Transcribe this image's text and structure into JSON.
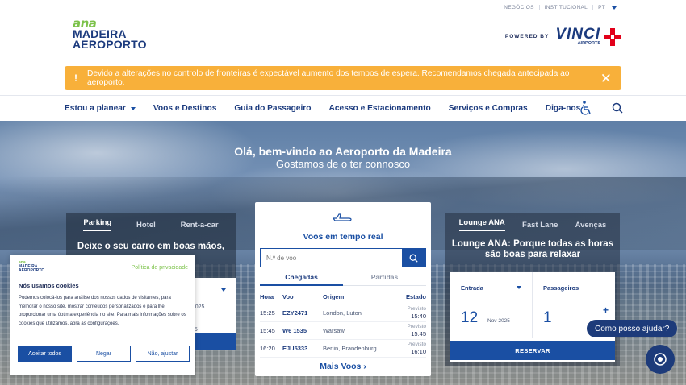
{
  "topbar": {
    "links": [
      "NEGÓCIOS",
      "INSTITUCIONAL"
    ],
    "language": "PT"
  },
  "logo": {
    "ana": "ana",
    "line1": "MADEIRA",
    "line2": "AEROPORTO"
  },
  "vinci": {
    "powered": "POWERED BY",
    "brand": "VINCI",
    "sub": "AIRPORTS"
  },
  "alert": {
    "icon": "!",
    "text": "Devido a alterações no controlo de fronteiras é expectável aumento dos tempos de espera. Recomendamos chegada antecipada ao aeroporto.",
    "close": "✕"
  },
  "nav": {
    "items": [
      "Estou a planear",
      "Voos e Destinos",
      "Guia do Passageiro",
      "Acesso e Estacionamento",
      "Serviços e Compras",
      "Diga-nos"
    ],
    "icons": [
      "accessibility-icon",
      "search-icon"
    ]
  },
  "hero": {
    "title": "Olá, bem-vindo ao Aeroporto da Madeira",
    "subtitle": "Gostamos de o ter connosco"
  },
  "parking": {
    "tabs": [
      "Parking",
      "Hotel",
      "Rent-a-car"
    ],
    "headline": "Deixe o seu carro em boas mãos,",
    "partial_date": "0 2025",
    "partial_time": "45"
  },
  "flights": {
    "title": "Voos em tempo real",
    "search_placeholder": "N.º de voo",
    "tabs": [
      "Chegadas",
      "Partidas"
    ],
    "columns": [
      "Hora",
      "Voo",
      "Origem",
      "Estado"
    ],
    "rows": [
      {
        "time": "15:25",
        "flight": "EZY2471",
        "origin": "London, Luton",
        "status": "Previsto",
        "status_time": "15:40"
      },
      {
        "time": "15:45",
        "flight": "W6 1535",
        "origin": "Warsaw",
        "status": "Previsto",
        "status_time": "15:45"
      },
      {
        "time": "16:20",
        "flight": "EJU5333",
        "origin": "Berlin, Brandenburg",
        "status": "Previsto",
        "status_time": "16:10"
      }
    ],
    "more": "Mais Voos"
  },
  "lounge": {
    "tabs": [
      "Lounge ANA",
      "Fast Lane",
      "Avenças"
    ],
    "headline1": "Lounge ANA: Porque todas as horas",
    "headline2": "são boas para relaxar",
    "entry_label": "Entrada",
    "entry_day": "12",
    "entry_month": "Nov 2025",
    "pax_label": "Passageiros",
    "pax_value": "1",
    "plus": "+",
    "reserve": "RESERVAR"
  },
  "cookie": {
    "policy": "Política de privacidade",
    "title": "Nós usamos cookies",
    "text": "Podemos colocá-los para análise dos nossos dados de visitantes, para melhorar o nosso site, mostrar conteúdos personalizados e para lhe proporcionar uma óptima experiência no site. Para mais informações sobre os cookies que utilizamos, abra as configurações.",
    "accept": "Aceitar todos",
    "deny": "Negar",
    "adjust": "Não, ajustar"
  },
  "help": {
    "label": "Como posso ajudar?"
  },
  "colors": {
    "primary": "#1a4fa3",
    "navy": "#1c3b7e",
    "green": "#7cc24a",
    "alert": "#f8b03a",
    "vinci_red": "#e2001a"
  }
}
